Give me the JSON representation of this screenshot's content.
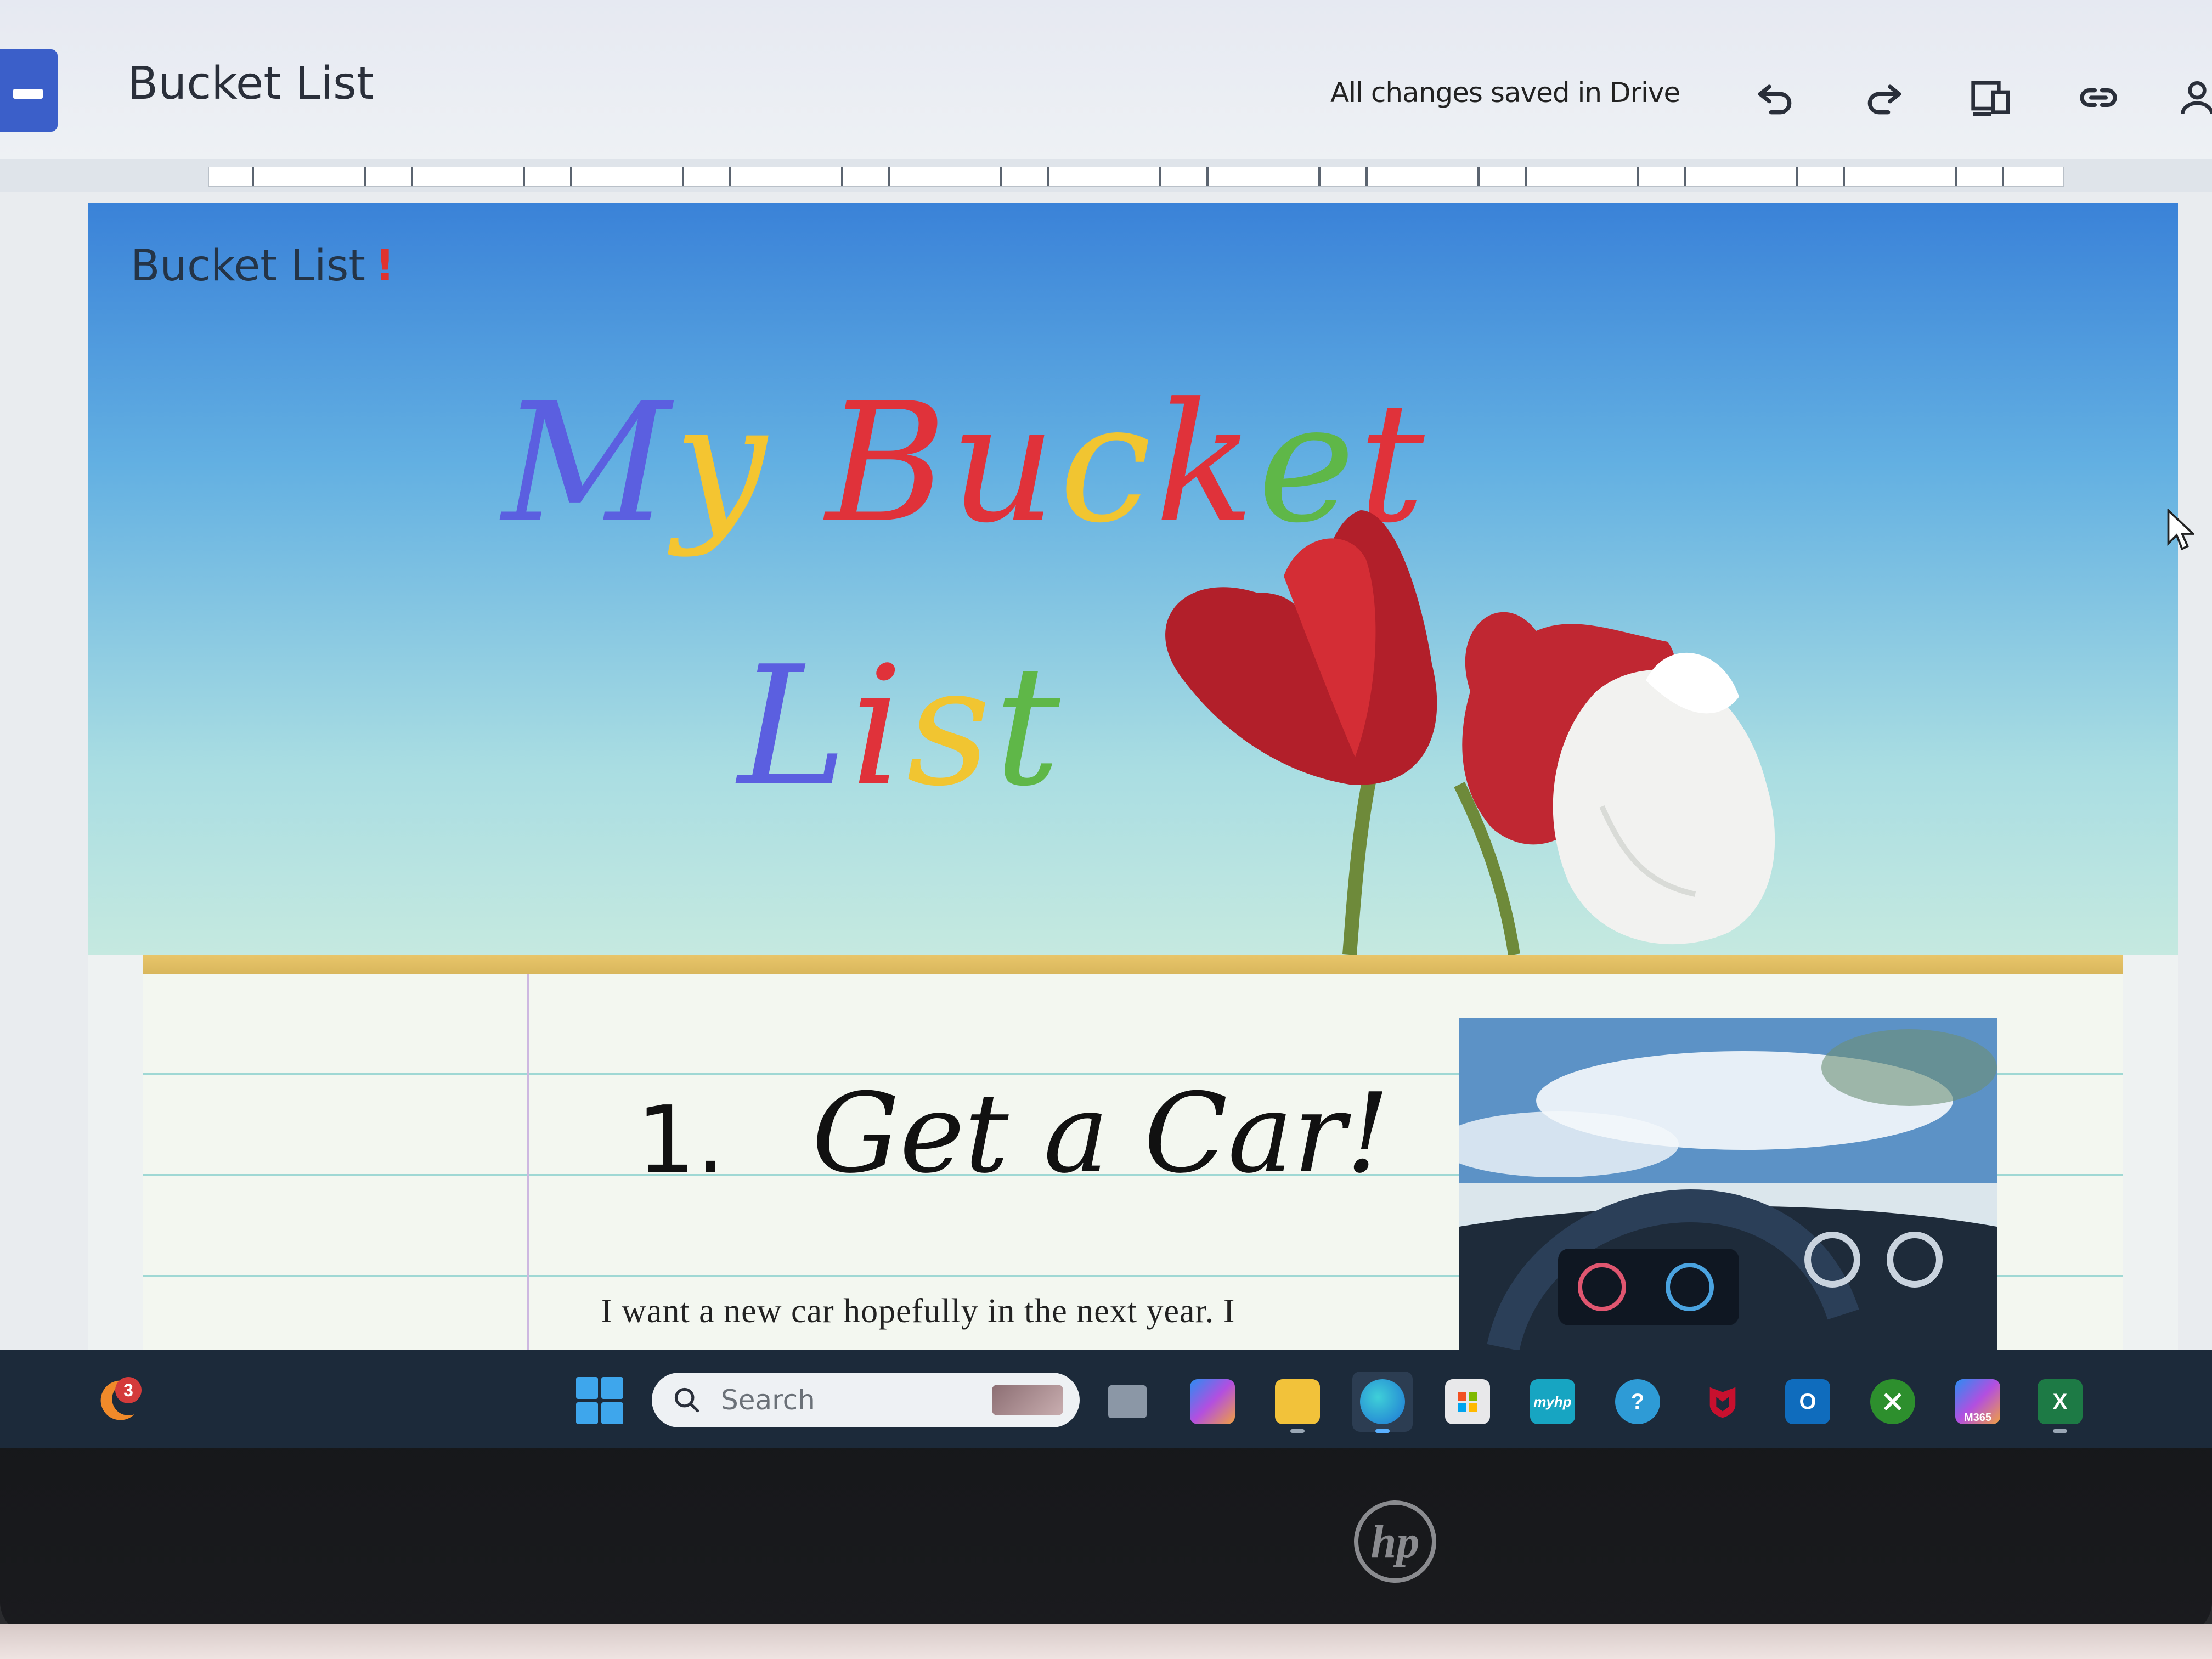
{
  "app": {
    "title": "Bucket List",
    "save_status": "All changes saved in Drive"
  },
  "toolbar": {
    "icons": [
      "undo-icon",
      "redo-icon",
      "devices-preview-icon",
      "link-icon",
      "share-person-icon"
    ]
  },
  "banner": {
    "corner_title": "Bucket List",
    "corner_mark": "!",
    "headline_line1": "My Bucket",
    "headline_line2": "List",
    "headline_colors": [
      "#5b5fe0",
      "#f4c531",
      "#e0323a",
      "#e0323a",
      "#f1c531",
      "#e0323a",
      "#5fb748",
      "#e0323a"
    ],
    "image_description_icon": "tulips-image"
  },
  "item": {
    "number": "1.",
    "title": "Get a Car!",
    "text": "I want a new car hopefully in the next year. I",
    "image_icon": "car-interior-photo"
  },
  "taskbar": {
    "weather_badge": "3",
    "search_placeholder": "Search",
    "apps": [
      {
        "name": "task-view",
        "label": ""
      },
      {
        "name": "copilot",
        "label": ""
      },
      {
        "name": "file-explorer",
        "label": ""
      },
      {
        "name": "edge",
        "label": ""
      },
      {
        "name": "microsoft-store",
        "label": ""
      },
      {
        "name": "myhp",
        "label": "myhp"
      },
      {
        "name": "get-help",
        "label": "?"
      },
      {
        "name": "mcafee",
        "label": ""
      },
      {
        "name": "outlook",
        "label": "O"
      },
      {
        "name": "xbox",
        "label": ""
      },
      {
        "name": "m365",
        "label": "M365"
      },
      {
        "name": "excel",
        "label": "X"
      }
    ]
  },
  "colors": {
    "accent": "#3b5fc9",
    "banner_top": "#3a82d8",
    "banner_bottom": "#c5e9e0",
    "gold": "#e9c66a",
    "taskbar": "#1c2a3a"
  }
}
